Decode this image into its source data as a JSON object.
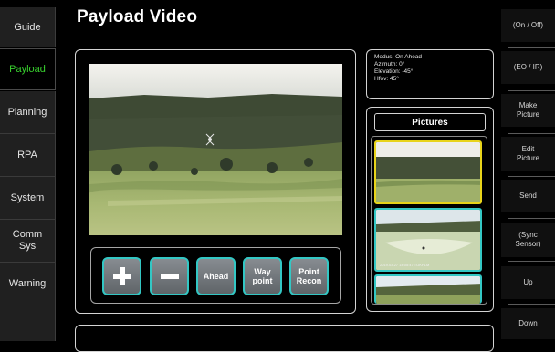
{
  "title": "Payload Video",
  "nav": {
    "guide": "Guide",
    "payload": "Payload",
    "planning": "Planning",
    "rpa": "RPA",
    "system": "System",
    "comm": "Comm Sys",
    "warning": "Warning"
  },
  "info": {
    "modus": "Modus: On  Ahead",
    "azimuth": "Azimuth: 0°",
    "elevation": "Elevation: -45°",
    "hfov": "Hfov: 45°"
  },
  "pictures": {
    "header": "Pictures",
    "thumb2_caption": "2019.03.27 14:05:47 TOKHLM"
  },
  "controls": {
    "zoom_in": "+",
    "zoom_out": "−",
    "ahead": "Ahead",
    "waypoint": "Way point",
    "point_recon": "Point Recon"
  },
  "side": {
    "on_off": "(On / Off)",
    "eo_ir": "(EO / IR)",
    "make_picture": "Make Picture",
    "edit_picture": "Edit Picture",
    "send": "Send",
    "sync_sensor": "(Sync Sensor)",
    "up": "Up",
    "down": "Down"
  },
  "colors": {
    "accent_cyan": "#33c7c4",
    "active_green": "#38d02e",
    "selected_yellow": "#e8d41a"
  }
}
